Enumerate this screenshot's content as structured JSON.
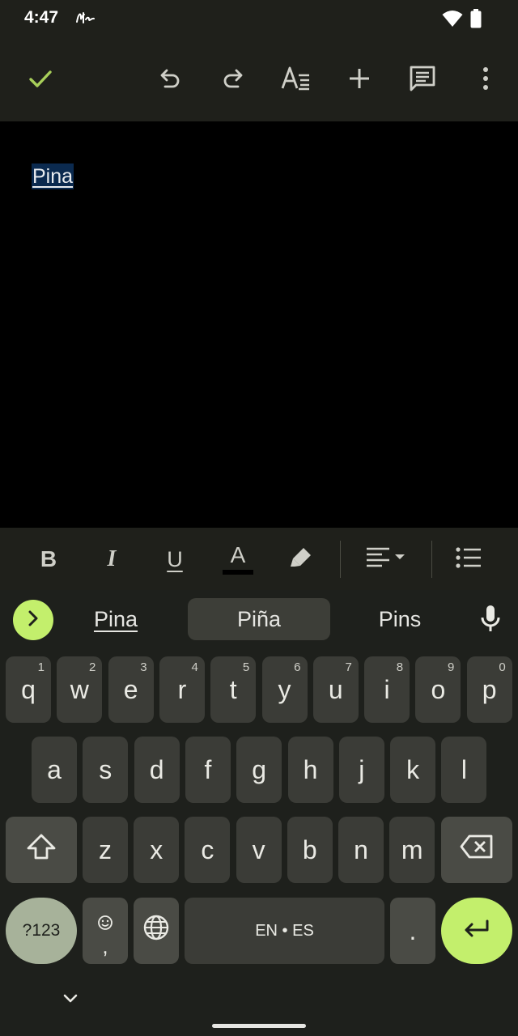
{
  "status": {
    "time": "4:47"
  },
  "toolbar": {
    "icons": [
      "check-icon",
      "undo-icon",
      "redo-icon",
      "text-format-icon",
      "add-icon",
      "comment-icon",
      "more-vert-icon"
    ],
    "accent": "#a8cf5a"
  },
  "document": {
    "text": "Pina"
  },
  "format_bar": {
    "bold": "B",
    "italic": "I",
    "underline": "U",
    "text_color": "A"
  },
  "suggestions": {
    "left": "Pina",
    "middle": "Piña",
    "right": "Pins"
  },
  "keyboard": {
    "row1": [
      {
        "k": "q",
        "h": "1"
      },
      {
        "k": "w",
        "h": "2"
      },
      {
        "k": "e",
        "h": "3"
      },
      {
        "k": "r",
        "h": "4"
      },
      {
        "k": "t",
        "h": "5"
      },
      {
        "k": "y",
        "h": "6"
      },
      {
        "k": "u",
        "h": "7"
      },
      {
        "k": "i",
        "h": "8"
      },
      {
        "k": "o",
        "h": "9"
      },
      {
        "k": "p",
        "h": "0"
      }
    ],
    "row2": [
      "a",
      "s",
      "d",
      "f",
      "g",
      "h",
      "j",
      "k",
      "l"
    ],
    "row3": [
      "z",
      "x",
      "c",
      "v",
      "b",
      "n",
      "m"
    ],
    "symbols_label": "?123",
    "emoji_comma": ",",
    "space_label": "EN • ES",
    "period": ".",
    "accent": "#c3ef6c"
  }
}
